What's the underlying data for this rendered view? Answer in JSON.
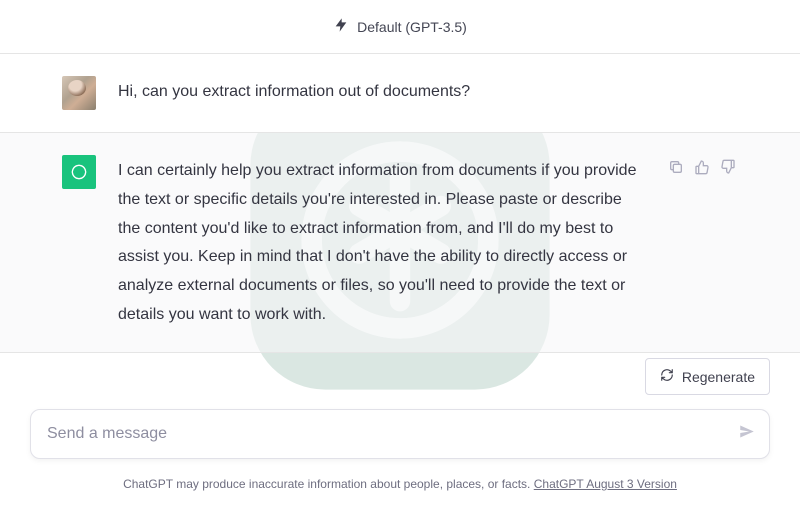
{
  "header": {
    "model_label": "Default (GPT-3.5)"
  },
  "conversation": {
    "user_message": "Hi, can you extract information out of documents?",
    "assistant_message": "I can certainly help you extract information from documents if you provide the text or specific details you're interested in. Please paste or describe the content you'd like to extract information from, and I'll do my best to assist you. Keep in mind that I don't have the ability to directly access or analyze external documents or files, so you'll need to provide the text or details you want to work with."
  },
  "controls": {
    "regenerate_label": "Regenerate",
    "input_placeholder": "Send a message"
  },
  "footer": {
    "disclaimer": "ChatGPT may produce inaccurate information about people, places, or facts. ",
    "version_link": "ChatGPT August 3 Version"
  }
}
